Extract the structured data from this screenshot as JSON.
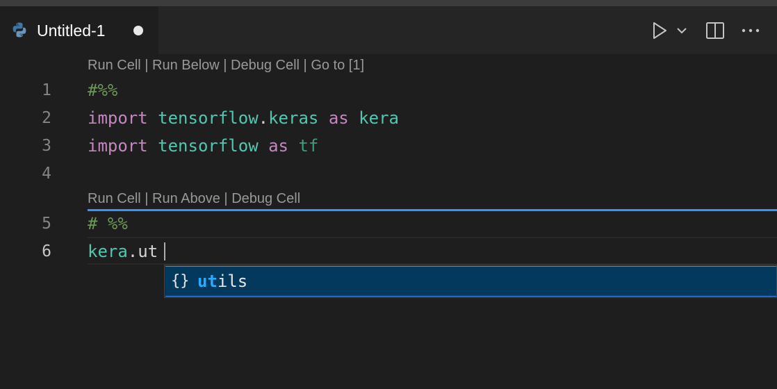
{
  "tab": {
    "title": "Untitled-1",
    "icon": "python-icon",
    "dirty": true
  },
  "toolbar": {
    "run_icon": "play-icon",
    "dropdown_icon": "chevron-down-icon",
    "split_icon": "split-editor-icon",
    "more_icon": "more-icon"
  },
  "editor": {
    "codelens_1": {
      "run_cell": "Run Cell",
      "sep_1": " | ",
      "run_below": "Run Below",
      "sep_2": " | ",
      "debug_cell": "Debug Cell",
      "sep_3": " | ",
      "go_to": "Go to [1]"
    },
    "codelens_2": {
      "run_cell": "Run Cell",
      "sep_1": " | ",
      "run_above": "Run Above",
      "sep_2": " | ",
      "debug_cell": "Debug Cell"
    },
    "line_numbers": [
      "1",
      "2",
      "3",
      "4",
      "5",
      "6"
    ],
    "lines": [
      {
        "t1": "#%%"
      },
      {
        "t1": "import",
        "t2": " ",
        "t3": "tensorflow",
        "t4": ".",
        "t5": "keras",
        "t6": " ",
        "t7": "as",
        "t8": " ",
        "t9": "kera"
      },
      {
        "t1": "import",
        "t2": " ",
        "t3": "tensorflow",
        "t4": " ",
        "t5": "as",
        "t6": " ",
        "t7": "tf"
      },
      {},
      {
        "t1": "# %%"
      },
      {
        "t1": "kera",
        "t2": ".ut"
      }
    ]
  },
  "suggest": {
    "icon_glyph": "{}",
    "icon": "module-braces-icon",
    "match": "ut",
    "rest": "ils"
  },
  "colors": {
    "accent": "#3794ff",
    "comment": "#6a9955",
    "keyword": "#c586c0",
    "module": "#4ec9b0",
    "suggest_selected": "#04395e"
  }
}
